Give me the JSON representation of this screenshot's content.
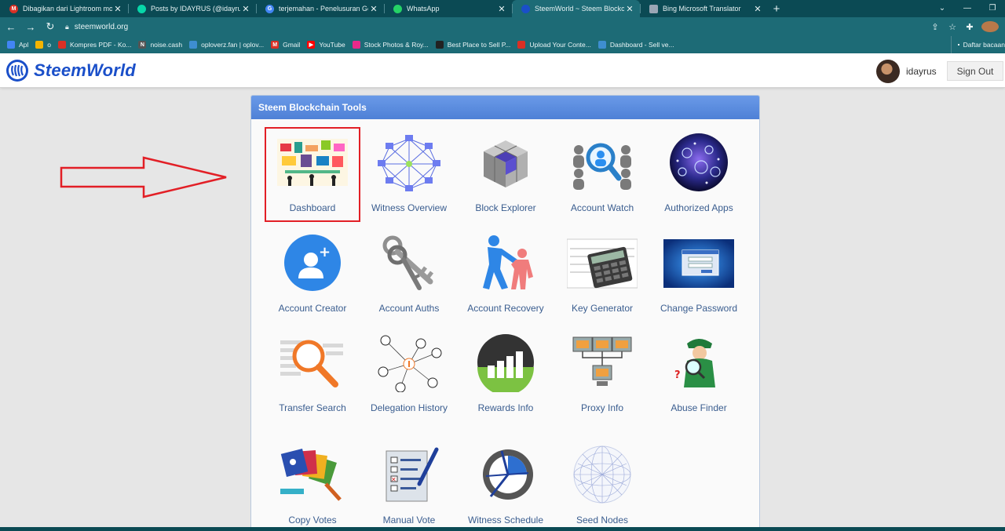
{
  "browser": {
    "tabs": [
      {
        "title": "Dibagikan dari Lightroom mobile",
        "favicon_color": "#d93025",
        "favicon_glyph": "M"
      },
      {
        "title": "Posts by IDAYRUS (@idayrus) —",
        "favicon_color": "#07d7a9",
        "favicon_glyph": ""
      },
      {
        "title": "terjemahan - Penelusuran Google",
        "favicon_color": "#4285f4",
        "favicon_glyph": "G"
      },
      {
        "title": "WhatsApp",
        "favicon_color": "#25d366",
        "favicon_glyph": ""
      },
      {
        "title": "SteemWorld ~ Steem Blockchain",
        "favicon_color": "#1a4fc9",
        "favicon_glyph": "",
        "active": true
      },
      {
        "title": "Bing Microsoft Translator",
        "favicon_color": "#9aa6b5",
        "favicon_glyph": ""
      }
    ],
    "url": "steemworld.org",
    "bookmarks": [
      {
        "label": "Apl",
        "color": "#4285f4"
      },
      {
        "label": "o",
        "color": "#f4b400"
      },
      {
        "label": "Kompres PDF - Ko...",
        "color": "#d93025"
      },
      {
        "label": "noise.cash",
        "color": "#555555"
      },
      {
        "label": "oploverz.fan | oplov...",
        "color": "#3e8ed0"
      },
      {
        "label": "Gmail",
        "color": "#d93025"
      },
      {
        "label": "YouTube",
        "color": "#ff0000"
      },
      {
        "label": "Stock Photos & Roy...",
        "color": "#e8298a"
      },
      {
        "label": "Best Place to Sell P...",
        "color": "#222222"
      },
      {
        "label": "Upload Your Conte...",
        "color": "#d93025"
      },
      {
        "label": "Dashboard - Sell ve...",
        "color": "#3e8ed0"
      }
    ],
    "bookmarks_more": "Daftar bacaan"
  },
  "site": {
    "logo_text": "SteemWorld",
    "username": "idayrus",
    "signout_label": "Sign Out"
  },
  "panel": {
    "title": "Steem Blockchain Tools",
    "tools": [
      {
        "label": "Dashboard",
        "icon": "dashboard-icon",
        "highlighted": true
      },
      {
        "label": "Witness Overview",
        "icon": "witness-overview-icon"
      },
      {
        "label": "Block Explorer",
        "icon": "block-explorer-icon"
      },
      {
        "label": "Account Watch",
        "icon": "account-watch-icon"
      },
      {
        "label": "Authorized Apps",
        "icon": "authorized-apps-icon"
      },
      {
        "label": "Account Creator",
        "icon": "account-creator-icon"
      },
      {
        "label": "Account Auths",
        "icon": "account-auths-icon"
      },
      {
        "label": "Account Recovery",
        "icon": "account-recovery-icon"
      },
      {
        "label": "Key Generator",
        "icon": "key-generator-icon"
      },
      {
        "label": "Change Password",
        "icon": "change-password-icon"
      },
      {
        "label": "Transfer Search",
        "icon": "transfer-search-icon"
      },
      {
        "label": "Delegation History",
        "icon": "delegation-history-icon"
      },
      {
        "label": "Rewards Info",
        "icon": "rewards-info-icon"
      },
      {
        "label": "Proxy Info",
        "icon": "proxy-info-icon"
      },
      {
        "label": "Abuse Finder",
        "icon": "abuse-finder-icon"
      },
      {
        "label": "Copy Votes",
        "icon": "copy-votes-icon"
      },
      {
        "label": "Manual Vote",
        "icon": "manual-vote-icon"
      },
      {
        "label": "Witness Schedule",
        "icon": "witness-schedule-icon"
      },
      {
        "label": "Seed Nodes",
        "icon": "seed-nodes-icon"
      }
    ]
  },
  "annotation": {
    "arrow_color": "#e21f26",
    "highlight_color": "#e21f26"
  }
}
